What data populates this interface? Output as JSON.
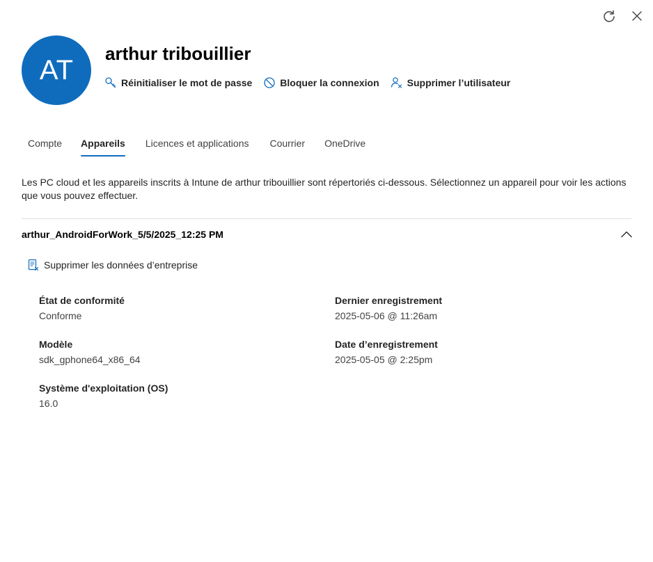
{
  "window": {
    "refresh_icon": "refresh-icon",
    "close_icon": "close-icon"
  },
  "user": {
    "initials": "AT",
    "name": "arthur tribouillier",
    "avatar_color": "#0f6cbd"
  },
  "actions": [
    {
      "label": "Réinitialiser le mot de passe",
      "icon": "key-icon"
    },
    {
      "label": "Bloquer la connexion",
      "icon": "block-icon"
    },
    {
      "label": "Supprimer l’utilisateur",
      "icon": "delete-user-icon"
    }
  ],
  "tabs": [
    {
      "label": "Compte",
      "active": false
    },
    {
      "label": "Appareils",
      "active": true
    },
    {
      "label": "Licences et applications",
      "active": false
    },
    {
      "label": "Courrier",
      "active": false
    },
    {
      "label": "OneDrive",
      "active": false
    }
  ],
  "description": "Les PC cloud et les appareils inscrits à Intune de arthur tribouillier sont répertoriés ci-dessous. Sélectionnez un appareil pour voir les actions que vous pouvez effectuer.",
  "device": {
    "name": "arthur_AndroidForWork_5/5/2025_12:25 PM",
    "expanded": true,
    "wipe_label": "Supprimer les données d’entreprise",
    "properties": {
      "compliance": {
        "label": "État de conformité",
        "value": "Conforme"
      },
      "last_checkin": {
        "label": "Dernier enregistrement",
        "value": "2025-05-06 @ 11:26am"
      },
      "model": {
        "label": "Modèle",
        "value": "sdk_gphone64_x86_64"
      },
      "enrolled": {
        "label": "Date d’enregistrement",
        "value": "2025-05-05 @ 2:25pm"
      },
      "os": {
        "label": "Système d'exploitation (OS)",
        "value": "16.0"
      }
    }
  },
  "colors": {
    "accent": "#0f6cbd",
    "text": "#242424"
  }
}
